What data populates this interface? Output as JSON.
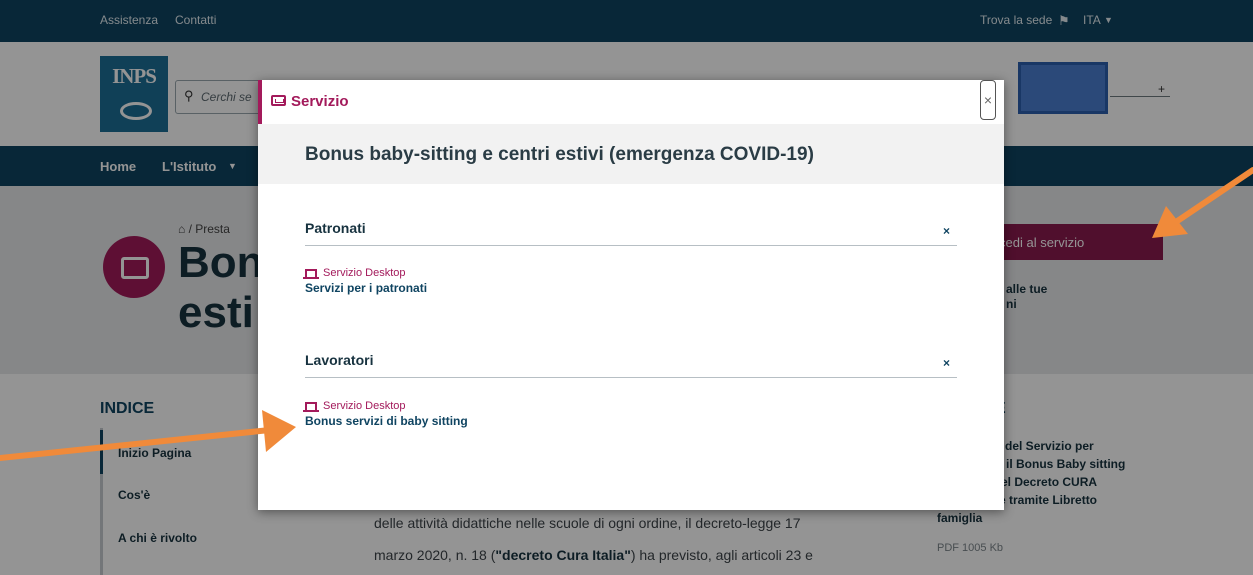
{
  "topbar": {
    "assistenza": "Assistenza",
    "contatti": "Contatti",
    "trova": "Trova la sede",
    "lang": "ITA"
  },
  "logo": {
    "text": "INPS"
  },
  "search": {
    "placeholder": "Cerchi se"
  },
  "nav": {
    "home": "Home",
    "istituto": "L'Istituto"
  },
  "hero": {
    "breadcrumb": "/ Presta",
    "title_line1": "Bon",
    "title_line2": "esti",
    "access_label": "cedi al servizio",
    "dati_line1": "alle tue",
    "dati_line2": "ni"
  },
  "index": {
    "title": "INDICE",
    "items": [
      "Inizio Pagina",
      "Cos'è",
      "A chi è rivolto"
    ]
  },
  "body": {
    "line1_pre": "delle attività didattiche nelle scuole di ogni ordine, il decreto-legge 17",
    "line2_pre": "marzo 2020, n. 18 (",
    "line2_bold": "\"decreto Cura Italia\"",
    "line2_post": ") ha previsto, agli articoli 23 e"
  },
  "right": {
    "header": "E",
    "doc_line1": "aso del Servizio per",
    "doc_line2": "il Bonus Baby sitting",
    "doc_line3": "el Decreto CURA",
    "doc_line4": "bile tramite Libretto",
    "doc_line5": "famiglia",
    "pdf": "PDF 1005 Kb"
  },
  "modal": {
    "header_label": "Servizio",
    "close": "×",
    "title": "Bonus baby-sitting e centri estivi (emergenza COVID-19)",
    "sections": [
      {
        "name": "Patronati",
        "collapse": "×",
        "service_type": "Servizio Desktop",
        "service_name": "Servizi per i patronati"
      },
      {
        "name": "Lavoratori",
        "collapse": "×",
        "service_type": "Servizio Desktop",
        "service_name": "Bonus servizi di baby sitting"
      }
    ]
  },
  "plus": {
    "symbol": "+"
  },
  "colors": {
    "navy": "#0f4461",
    "brand": "#a31a5b",
    "arrow": "#f08a3a",
    "highlight_box": "#4a7fd0"
  }
}
